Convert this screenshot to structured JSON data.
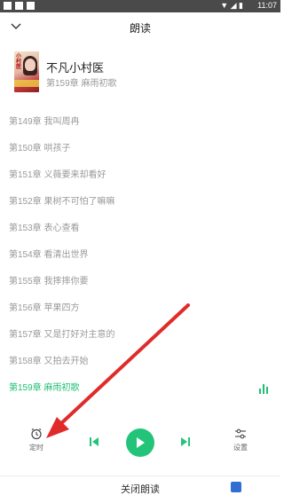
{
  "status_bar": {
    "time": "11:07"
  },
  "header": {
    "title": "朗读"
  },
  "book": {
    "name": "不凡小村医",
    "current_chapter": "第159章 麻雨初歌",
    "cover_text": "小村医"
  },
  "chapters": [
    {
      "label": "第149章 我叫周冉"
    },
    {
      "label": "第150章 哄孩子"
    },
    {
      "label": "第151章 义薇要来却看好"
    },
    {
      "label": "第152章 果树不可怕了嘛嘛"
    },
    {
      "label": "第153章 表心查看"
    },
    {
      "label": "第154章 看清出世界"
    },
    {
      "label": "第155章 我摔摔你要"
    },
    {
      "label": "第156章 苹果四方"
    },
    {
      "label": "第157章 又是打好对主意的"
    },
    {
      "label": "第158章 又拍去开始"
    },
    {
      "label": "第159章 麻雨初歌",
      "active": true
    }
  ],
  "controls": {
    "timer_label": "定时",
    "settings_label": "设置"
  },
  "footer": {
    "close_label": "关闭朗读"
  },
  "colors": {
    "accent": "#1fbf73",
    "arrow": "#e02b2b"
  }
}
